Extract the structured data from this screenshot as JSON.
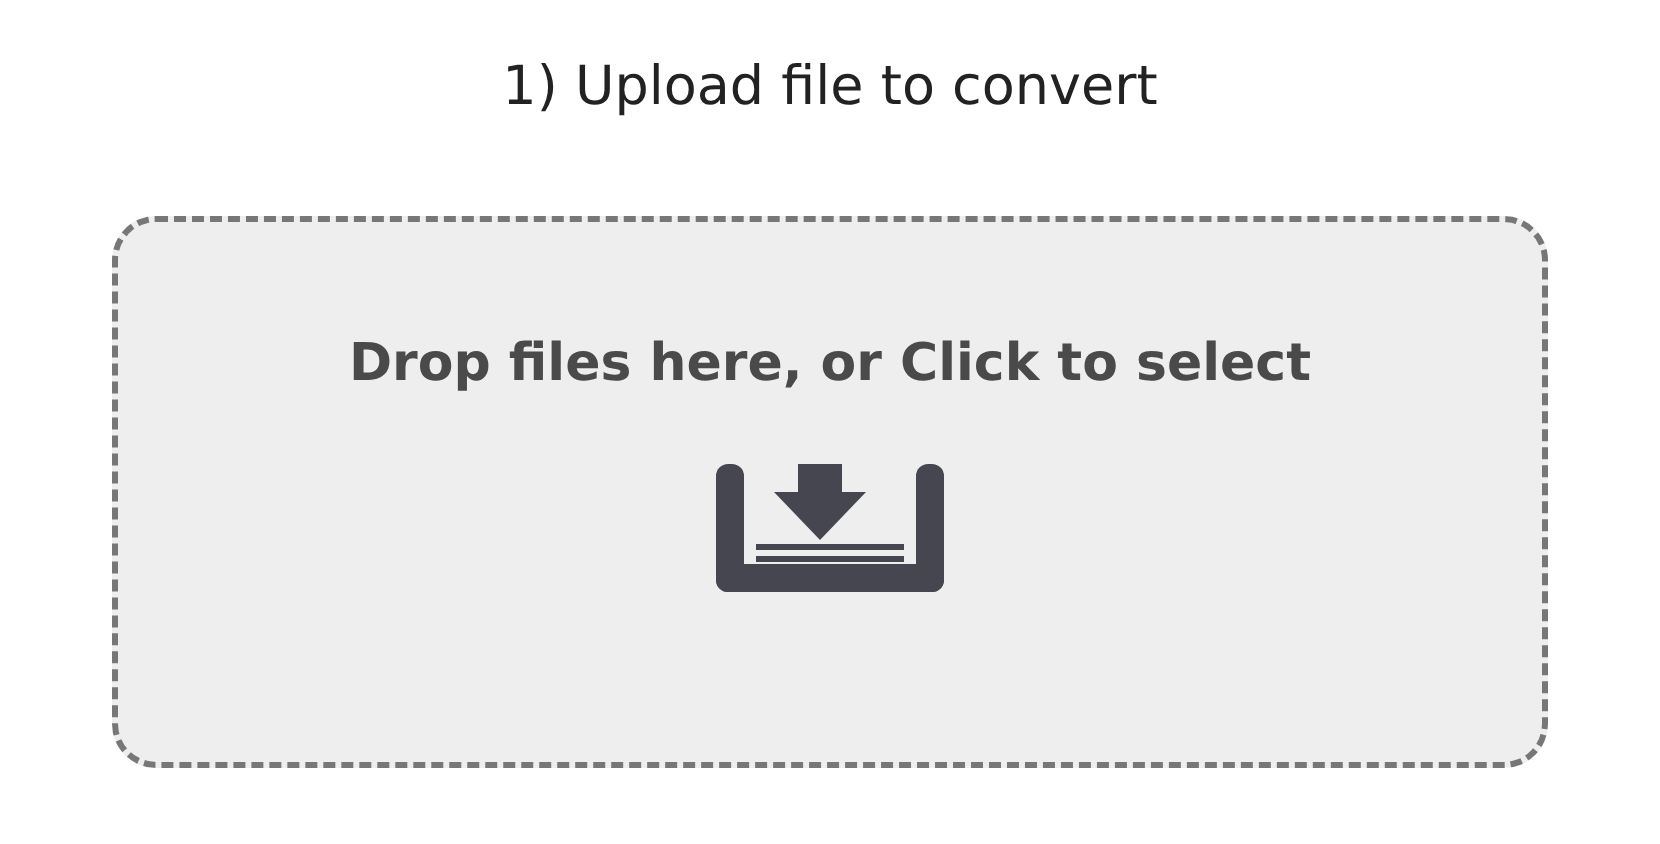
{
  "heading": "1) Upload file to convert",
  "dropzone": {
    "label": "Drop files here, or Click to select"
  }
}
